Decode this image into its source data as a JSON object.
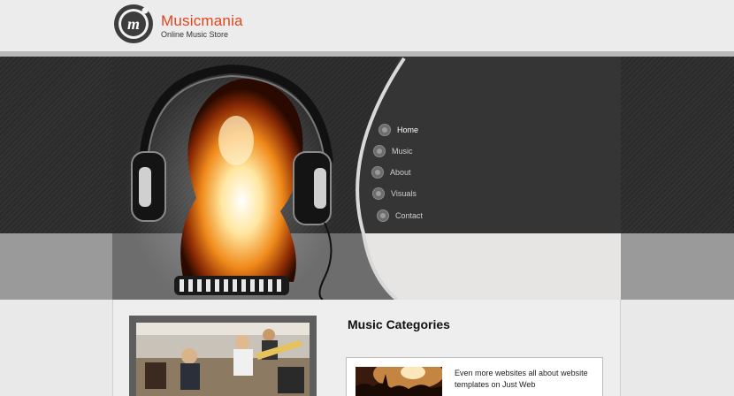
{
  "brand": {
    "title": "Musicmania",
    "subtitle": "Online Music Store",
    "logo_letter": "m"
  },
  "nav": {
    "items": [
      {
        "label": "Home",
        "active": true
      },
      {
        "label": "Music",
        "active": false
      },
      {
        "label": "About",
        "active": false
      },
      {
        "label": "Visuals",
        "active": false
      },
      {
        "label": "Contact",
        "active": false
      }
    ]
  },
  "content": {
    "section_title": "Music Categories",
    "category_text": "Even more websites all about website templates on Just Web"
  },
  "colors": {
    "brand_accent": "#e0461b",
    "hero_dark": "#2c2c2c",
    "panel": "#353535"
  },
  "icons": {
    "logo": "music-logo-icon",
    "nav_bullet": "bullet-icon"
  }
}
